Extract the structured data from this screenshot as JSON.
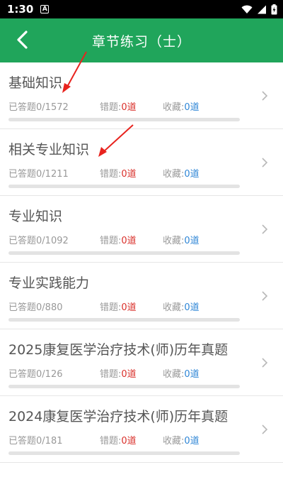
{
  "status_bar": {
    "time": "1:30",
    "notification_letter": "A",
    "icons": [
      "wifi-icon",
      "signal-icon",
      "battery-icon"
    ]
  },
  "header": {
    "title": "章节练习（士）",
    "back_icon": "back-chevron-icon",
    "background_color": "#20a55b"
  },
  "labels": {
    "done_prefix": "已答题",
    "wrong_prefix": "错题:",
    "fav_prefix": "收藏:",
    "unit": "道"
  },
  "chapters": [
    {
      "title": "基础知识",
      "answered": "0/1572",
      "wrong": "0",
      "favorites": "0",
      "progress": 0
    },
    {
      "title": "相关专业知识",
      "answered": "0/1211",
      "wrong": "0",
      "favorites": "0",
      "progress": 0
    },
    {
      "title": "专业知识",
      "answered": "0/1092",
      "wrong": "0",
      "favorites": "0",
      "progress": 0
    },
    {
      "title": "专业实践能力",
      "answered": "0/880",
      "wrong": "0",
      "favorites": "0",
      "progress": 0
    },
    {
      "title": "2025康复医学治疗技术(师)历年真题",
      "answered": "0/126",
      "wrong": "0",
      "favorites": "0",
      "progress": 0
    },
    {
      "title": "2024康复医学治疗技术(师)历年真题",
      "answered": "0/181",
      "wrong": "0",
      "favorites": "0",
      "progress": 0
    }
  ],
  "colors": {
    "accent": "#20a55b",
    "wrong": "#d9302b",
    "favorites": "#2f86d6",
    "annotation_arrow": "#e8231e"
  }
}
